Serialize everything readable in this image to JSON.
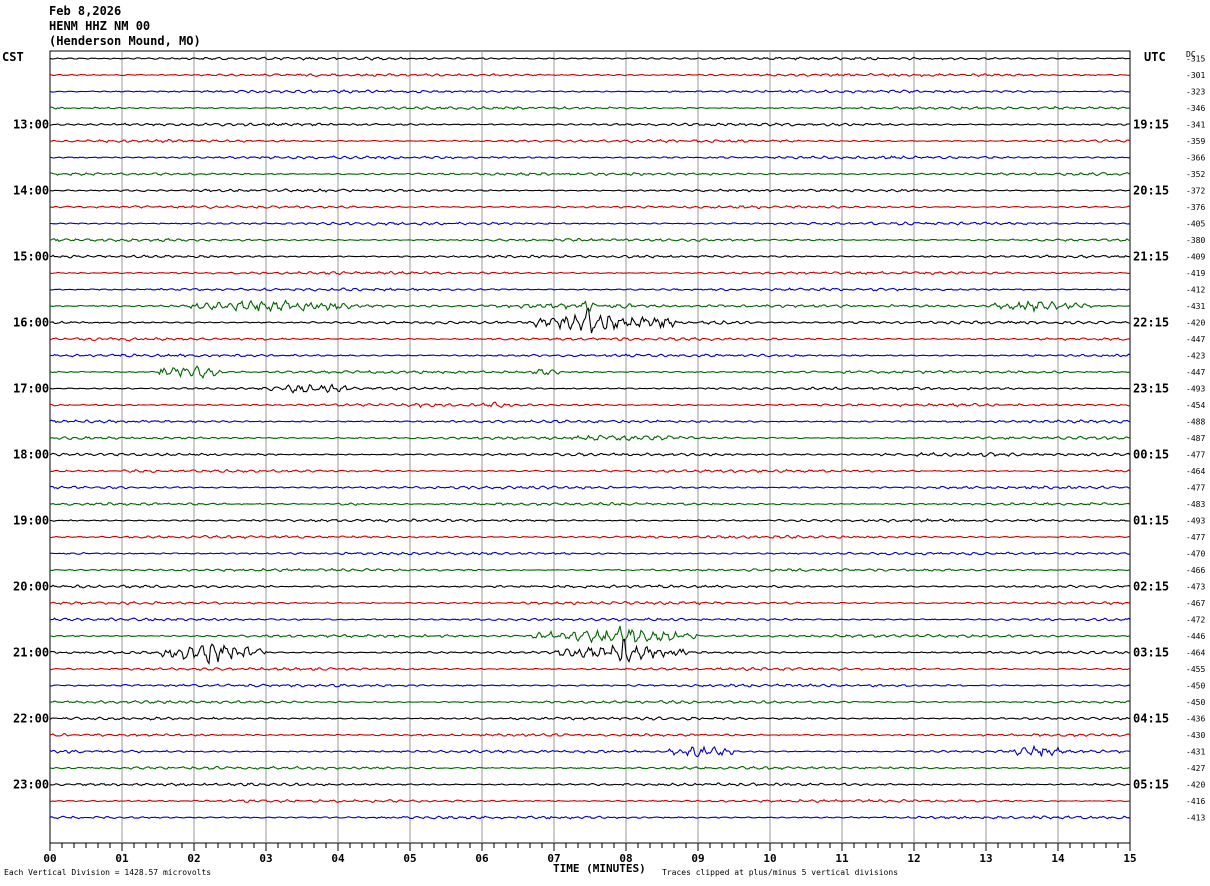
{
  "header": {
    "date": "Feb 8,2026",
    "station": "HENM HHZ NM 00",
    "location": "(Henderson Mound, MO)"
  },
  "left_zone": "CST",
  "right_zone": "UTC",
  "dc_label": "DC",
  "footer": {
    "left": "Each Vertical Division = 1428.57 microvolts",
    "right": "Traces clipped at plus/minus 5 vertical divisions"
  },
  "chart_data": {
    "type": "line",
    "title": "",
    "xlabel": "TIME (MINUTES)",
    "x_ticks": [
      "00",
      "01",
      "02",
      "03",
      "04",
      "05",
      "06",
      "07",
      "08",
      "09",
      "10",
      "11",
      "12",
      "13",
      "14",
      "15"
    ],
    "xlim": [
      0,
      15
    ],
    "trace_colors": [
      "#000000",
      "#cc0000",
      "#0000bb",
      "#006600"
    ],
    "left_hour_labels": [
      "13:00",
      "14:00",
      "15:00",
      "16:00",
      "17:00",
      "18:00",
      "19:00",
      "20:00",
      "21:00",
      "22:00",
      "23:00"
    ],
    "right_hour_labels": [
      "19:15",
      "20:15",
      "21:15",
      "22:15",
      "23:15",
      "00:15",
      "01:15",
      "02:15",
      "03:15",
      "04:15",
      "05:15"
    ],
    "dc_offsets": [
      "-315",
      "-301",
      "-323",
      "-346",
      "-341",
      "-359",
      "-366",
      "-352",
      "-372",
      "-376",
      "-405",
      "-380",
      "-409",
      "-419",
      "-412",
      "-431",
      "-420",
      "-447",
      "-423",
      "-447",
      "-493",
      "-454",
      "-488",
      "-487",
      "-477",
      "-464",
      "-477",
      "-483",
      "-493",
      "-477",
      "-470",
      "-466",
      "-473",
      "-467",
      "-472",
      "-446",
      "-464",
      "-455",
      "-450",
      "-450",
      "-436",
      "-430",
      "-431",
      "-427",
      "-420",
      "-416",
      "-413"
    ],
    "events": [
      {
        "trace": 15,
        "start": 1.95,
        "end": 4.3,
        "amp": 6
      },
      {
        "trace": 15,
        "start": 6.0,
        "end": 8.6,
        "amp": 3
      },
      {
        "trace": 15,
        "start": 7.4,
        "end": 7.55,
        "amp": 10
      },
      {
        "trace": 15,
        "start": 13.0,
        "end": 14.5,
        "amp": 5
      },
      {
        "trace": 16,
        "start": 6.7,
        "end": 8.7,
        "amp": 9
      },
      {
        "trace": 16,
        "start": 7.35,
        "end": 7.6,
        "amp": 14
      },
      {
        "trace": 16,
        "start": 8.7,
        "end": 10.0,
        "amp": 2
      },
      {
        "trace": 17,
        "start": 1.0,
        "end": 1.2,
        "amp": 3
      },
      {
        "trace": 19,
        "start": 1.5,
        "end": 2.4,
        "amp": 7
      },
      {
        "trace": 19,
        "start": 6.7,
        "end": 7.1,
        "amp": 4
      },
      {
        "trace": 20,
        "start": 3.0,
        "end": 4.3,
        "amp": 5
      },
      {
        "trace": 21,
        "start": 5.0,
        "end": 5.2,
        "amp": 3
      },
      {
        "trace": 21,
        "start": 5.95,
        "end": 6.4,
        "amp": 3
      },
      {
        "trace": 23,
        "start": 6.8,
        "end": 9.0,
        "amp": 3
      },
      {
        "trace": 24,
        "start": 11.0,
        "end": 14.2,
        "amp": 2
      },
      {
        "trace": 27,
        "start": 4.0,
        "end": 4.3,
        "amp": 2
      },
      {
        "trace": 35,
        "start": 6.7,
        "end": 9.0,
        "amp": 7
      },
      {
        "trace": 35,
        "start": 7.7,
        "end": 8.2,
        "amp": 11
      },
      {
        "trace": 36,
        "start": 1.5,
        "end": 3.0,
        "amp": 9
      },
      {
        "trace": 36,
        "start": 2.1,
        "end": 2.3,
        "amp": 14
      },
      {
        "trace": 36,
        "start": 7.0,
        "end": 8.9,
        "amp": 7
      },
      {
        "trace": 36,
        "start": 7.8,
        "end": 8.1,
        "amp": 14
      },
      {
        "trace": 42,
        "start": 8.6,
        "end": 9.5,
        "amp": 6
      },
      {
        "trace": 42,
        "start": 13.3,
        "end": 14.1,
        "amp": 6
      }
    ]
  }
}
